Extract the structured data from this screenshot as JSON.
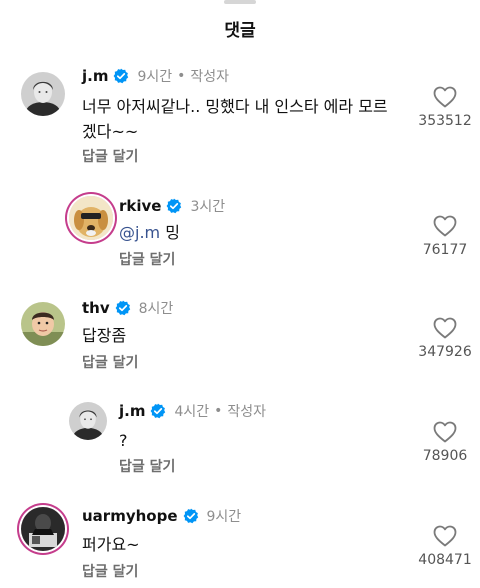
{
  "header": {
    "title": "댓글"
  },
  "comments": [
    {
      "username": "j.m",
      "time": "9시간",
      "dot": "•",
      "author_label": "작성자",
      "text": "너무 아저씨같나.. 밍했다 내 인스타 에라 모르겠다~~",
      "mention": "",
      "reply_label": "답글 달기",
      "likes": "353512",
      "avatar_icon": "grayscale-portrait-avatar"
    },
    {
      "username": "rkive",
      "time": "3시간",
      "dot": "",
      "author_label": "",
      "mention": "@j.m",
      "text": " 밍",
      "reply_label": "답글 달기",
      "likes": "76177",
      "avatar_icon": "golden-retriever-avatar"
    },
    {
      "username": "thv",
      "time": "8시간",
      "dot": "",
      "author_label": "",
      "text": "답장좀",
      "mention": "",
      "reply_label": "답글 달기",
      "likes": "347926",
      "avatar_icon": "child-photo-avatar"
    },
    {
      "username": "j.m",
      "time": "4시간",
      "dot": "•",
      "author_label": "작성자",
      "text": "?",
      "mention": "",
      "reply_label": "답글 달기",
      "likes": "78906",
      "avatar_icon": "grayscale-portrait-avatar"
    },
    {
      "username": "uarmyhope",
      "time": "9시간",
      "dot": "",
      "author_label": "",
      "text": "퍼가요~",
      "mention": "",
      "reply_label": "답글 달기",
      "likes": "408471",
      "avatar_icon": "dark-photo-avatar"
    }
  ],
  "colors": {
    "verified_badge": "#0095f6",
    "mention": "#38538f",
    "story_ring": "#c53d8c",
    "secondary_text": "#8e8e8e"
  }
}
